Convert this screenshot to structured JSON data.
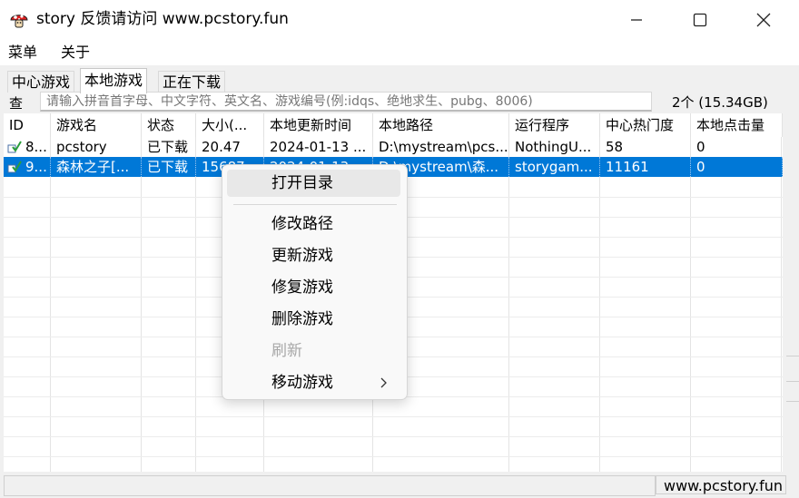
{
  "window": {
    "title": "story 反馈请访问 www.pcstory.fun"
  },
  "menubar": {
    "items": [
      "菜单",
      "关于"
    ]
  },
  "tabs": [
    {
      "label": "中心游戏",
      "active": false
    },
    {
      "label": "本地游戏",
      "active": true
    },
    {
      "label": "正在下载",
      "active": false
    }
  ],
  "search": {
    "label": "查",
    "placeholder": "请输入拼音首字母、中文字符、英文名、游戏编号(例:idqs、绝地求生、pubg、8006)",
    "count_text": "2个 (15.34GB)"
  },
  "table": {
    "columns": [
      "ID",
      "游戏名",
      "状态",
      "大小(...",
      "本地更新时间",
      "本地路径",
      "运行程序",
      "中心热门度",
      "本地点击量"
    ],
    "rows": [
      {
        "id": "8...",
        "name": "pcstory",
        "status": "已下载",
        "size": "20.47",
        "updated": "2024-01-13 ...",
        "path": "D:\\mystream\\pcs...",
        "exe": "NothingU...",
        "hot": "58",
        "clicks": "0",
        "selected": false
      },
      {
        "id": "9...",
        "name": "森林之子[...",
        "status": "已下载",
        "size": "15687...",
        "updated": "2024-01-13 ...",
        "path": "D:\\mystream\\森...",
        "exe": "storygam...",
        "hot": "11161",
        "clicks": "0",
        "selected": true
      }
    ]
  },
  "context_menu": {
    "items": [
      {
        "label": "打开目录",
        "state": "hover"
      },
      {
        "label": "修改路径",
        "state": "normal"
      },
      {
        "label": "更新游戏",
        "state": "normal"
      },
      {
        "label": "修复游戏",
        "state": "normal"
      },
      {
        "label": "删除游戏",
        "state": "normal"
      },
      {
        "label": "刷新",
        "state": "disabled"
      },
      {
        "label": "移动游戏",
        "state": "submenu"
      }
    ]
  },
  "statusbar": {
    "right_text": "www.pcstory.fun"
  },
  "colors": {
    "selection": "#0078d7",
    "titlebar_bg": "#ffffff",
    "window_bg": "#f0f0f0"
  },
  "icons": [
    "app-mushroom-icon",
    "minimize-icon",
    "maximize-icon",
    "close-icon",
    "installed-check-icon",
    "chevron-right-icon"
  ]
}
